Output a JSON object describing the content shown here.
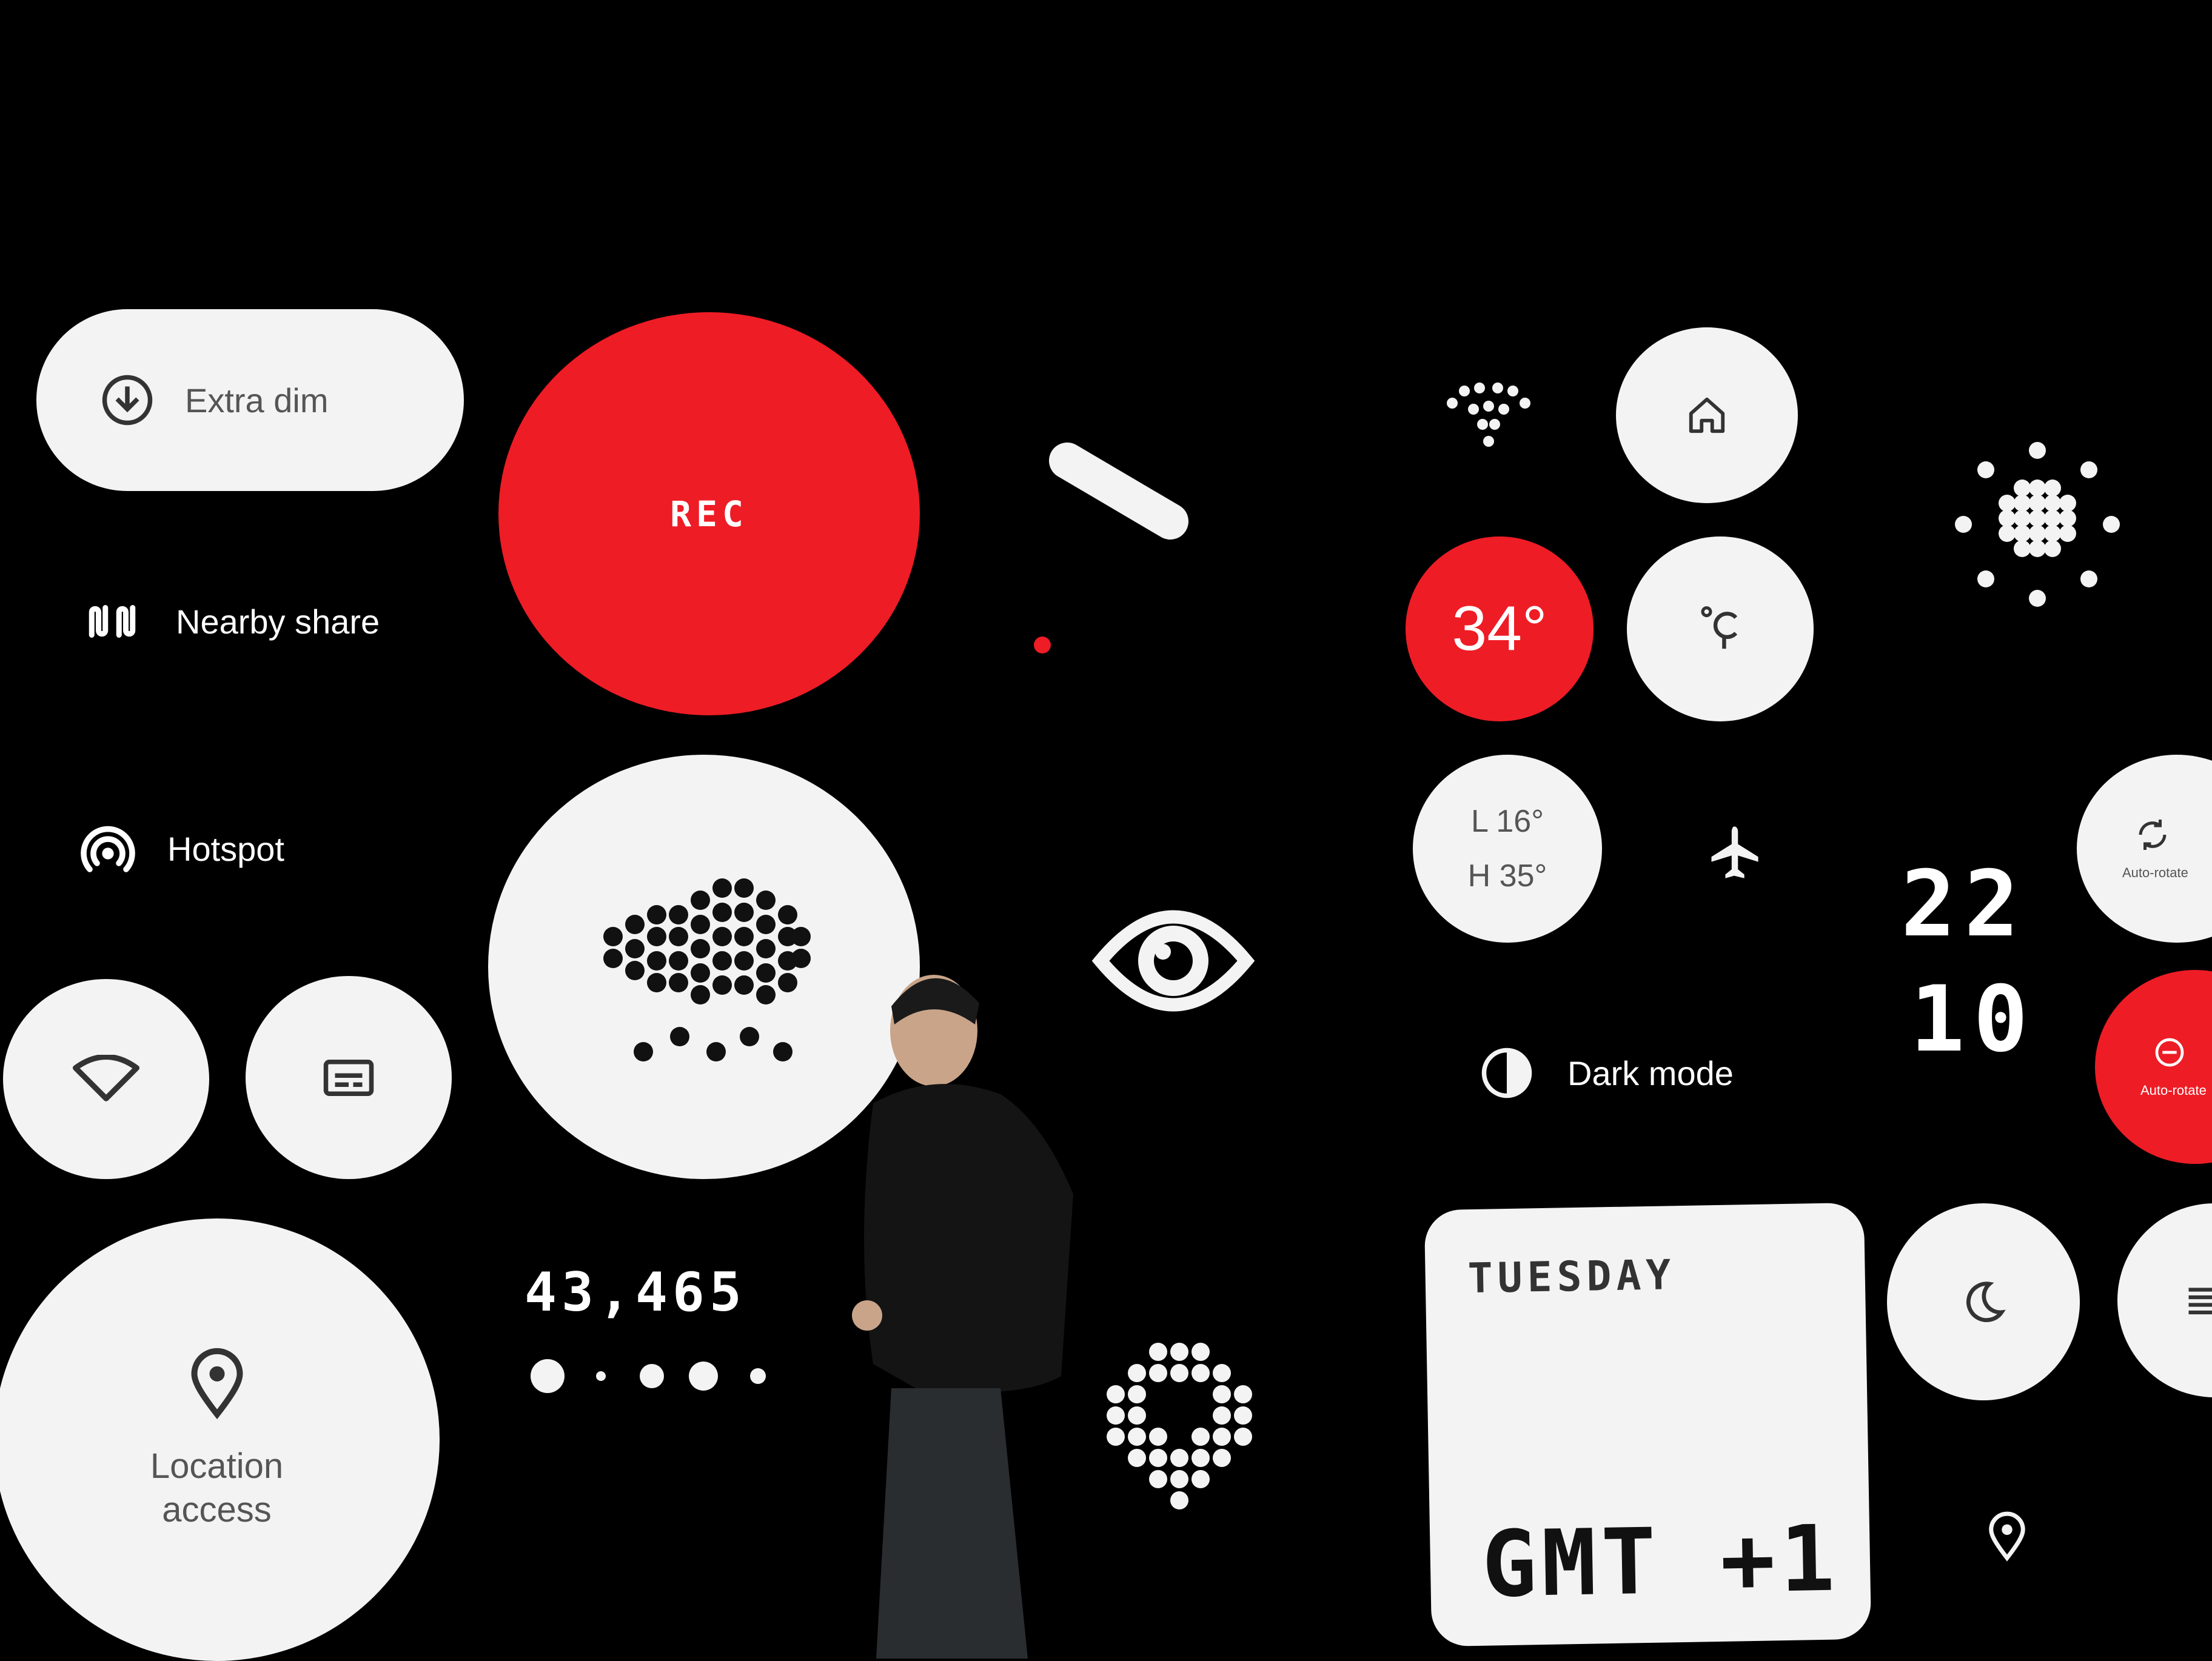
{
  "tiles": {
    "extra_dim": "Extra dim",
    "nearby_share": "Nearby share",
    "hotspot": "Hotspot",
    "location_access": "Location access",
    "rec": "REC",
    "counter": "43,465",
    "temp": "34°",
    "low": "L 16°",
    "high": "H 35°",
    "clock_hours": "22",
    "clock_minutes": "10",
    "auto_rotate": "Auto-rotate",
    "dark_mode": "Dark mode",
    "day": "TUESDAY",
    "timezone": "GMT +1"
  },
  "colors": {
    "accent": "#ee1c25",
    "tile": "#f3f3f3",
    "background": "#000000"
  },
  "icons": [
    "download-circle-icon",
    "nearby-share-icon",
    "hotspot-icon",
    "wifi-icon",
    "caption-icon",
    "location-pin-icon",
    "eye-icon",
    "home-icon",
    "celsius-icon",
    "airplane-icon",
    "auto-rotate-icon",
    "dnd-icon",
    "dark-mode-icon",
    "moon-icon",
    "wifi-dot-icon",
    "sun-dot-icon",
    "rain-cloud-icon",
    "pin-dot-icon"
  ]
}
